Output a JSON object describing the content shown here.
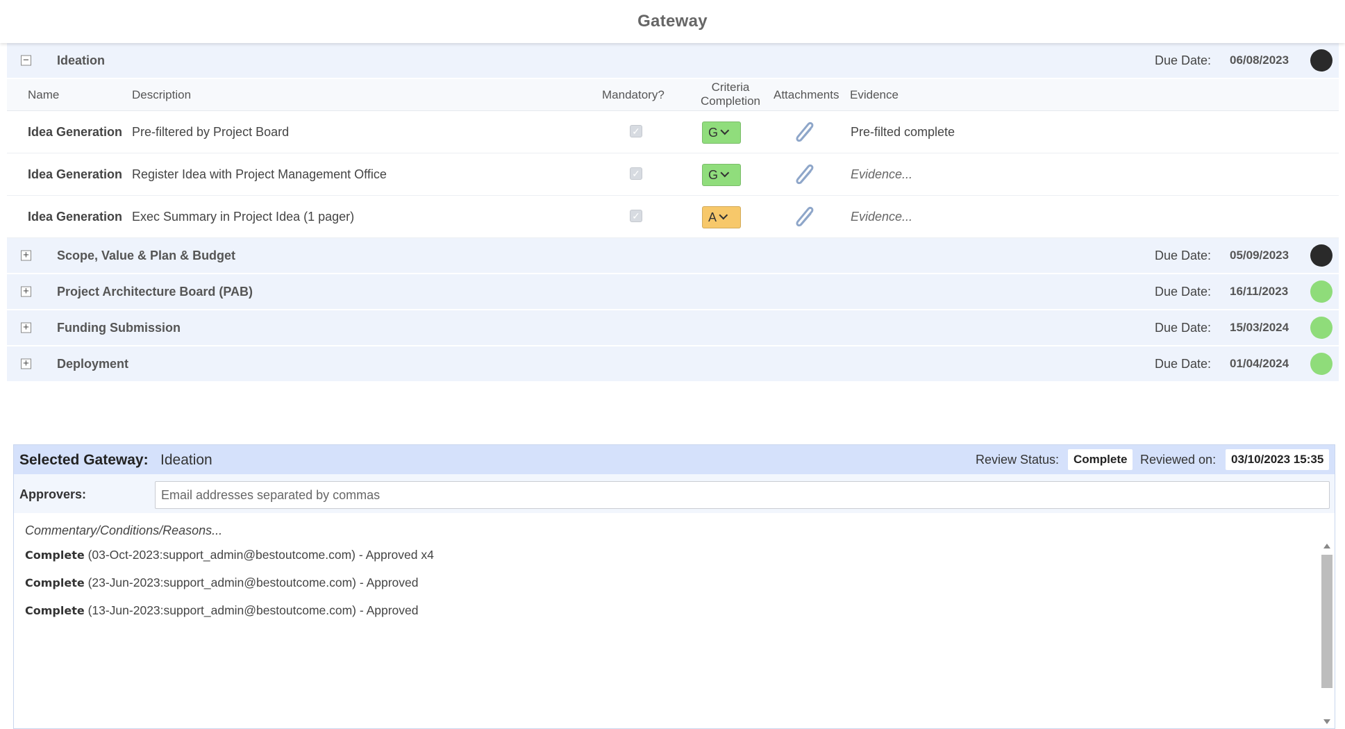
{
  "header": {
    "title": "Gateway"
  },
  "columns": {
    "name": "Name",
    "description": "Description",
    "mandatory": "Mandatory?",
    "criteria_line1": "Criteria",
    "criteria_line2": "Completion",
    "attachments": "Attachments",
    "evidence": "Evidence"
  },
  "due_label": "Due Date:",
  "gateways": [
    {
      "name": "Ideation",
      "toggle": "−",
      "due_date": "06/08/2023",
      "status_color": "#2a2a2a"
    },
    {
      "name": "Scope, Value & Plan & Budget",
      "toggle": "+",
      "due_date": "05/09/2023",
      "status_color": "#2a2a2a"
    },
    {
      "name": "Project Architecture Board (PAB)",
      "toggle": "+",
      "due_date": "16/11/2023",
      "status_color": "#8fdc7a"
    },
    {
      "name": "Funding Submission",
      "toggle": "+",
      "due_date": "15/03/2024",
      "status_color": "#8fdc7a"
    },
    {
      "name": "Deployment",
      "toggle": "+",
      "due_date": "01/04/2024",
      "status_color": "#8fdc7a"
    }
  ],
  "criteria": [
    {
      "name": "Idea Generation",
      "description": "Pre-filtered by Project Board",
      "mandatory": true,
      "rag": "G",
      "rag_color": "#90dd7c",
      "evidence": "Pre-filted complete",
      "evidence_is_placeholder": false
    },
    {
      "name": "Idea Generation",
      "description": "Register Idea with Project Management Office",
      "mandatory": true,
      "rag": "G",
      "rag_color": "#90dd7c",
      "evidence": "Evidence...",
      "evidence_is_placeholder": true
    },
    {
      "name": "Idea Generation",
      "description": "Exec Summary in Project Idea (1 pager)",
      "mandatory": true,
      "rag": "A",
      "rag_color": "#f7c86a",
      "evidence": "Evidence...",
      "evidence_is_placeholder": true
    }
  ],
  "selected": {
    "label": "Selected Gateway:",
    "value": "Ideation",
    "review_status_label": "Review Status:",
    "review_status": "Complete",
    "reviewed_on_label": "Reviewed on:",
    "reviewed_on": "03/10/2023 15:35",
    "approvers_label": "Approvers:",
    "approvers_placeholder": "Email addresses separated by commas",
    "commentary_placeholder": "Commentary/Conditions/Reasons...",
    "log": [
      {
        "status": "Complete",
        "text": " (03-Oct-2023:support_admin@bestoutcome.com) - Approved x4"
      },
      {
        "status": "Complete",
        "text": " (23-Jun-2023:support_admin@bestoutcome.com) - Approved"
      },
      {
        "status": "Complete",
        "text": " (13-Jun-2023:support_admin@bestoutcome.com) - Approved"
      }
    ]
  }
}
